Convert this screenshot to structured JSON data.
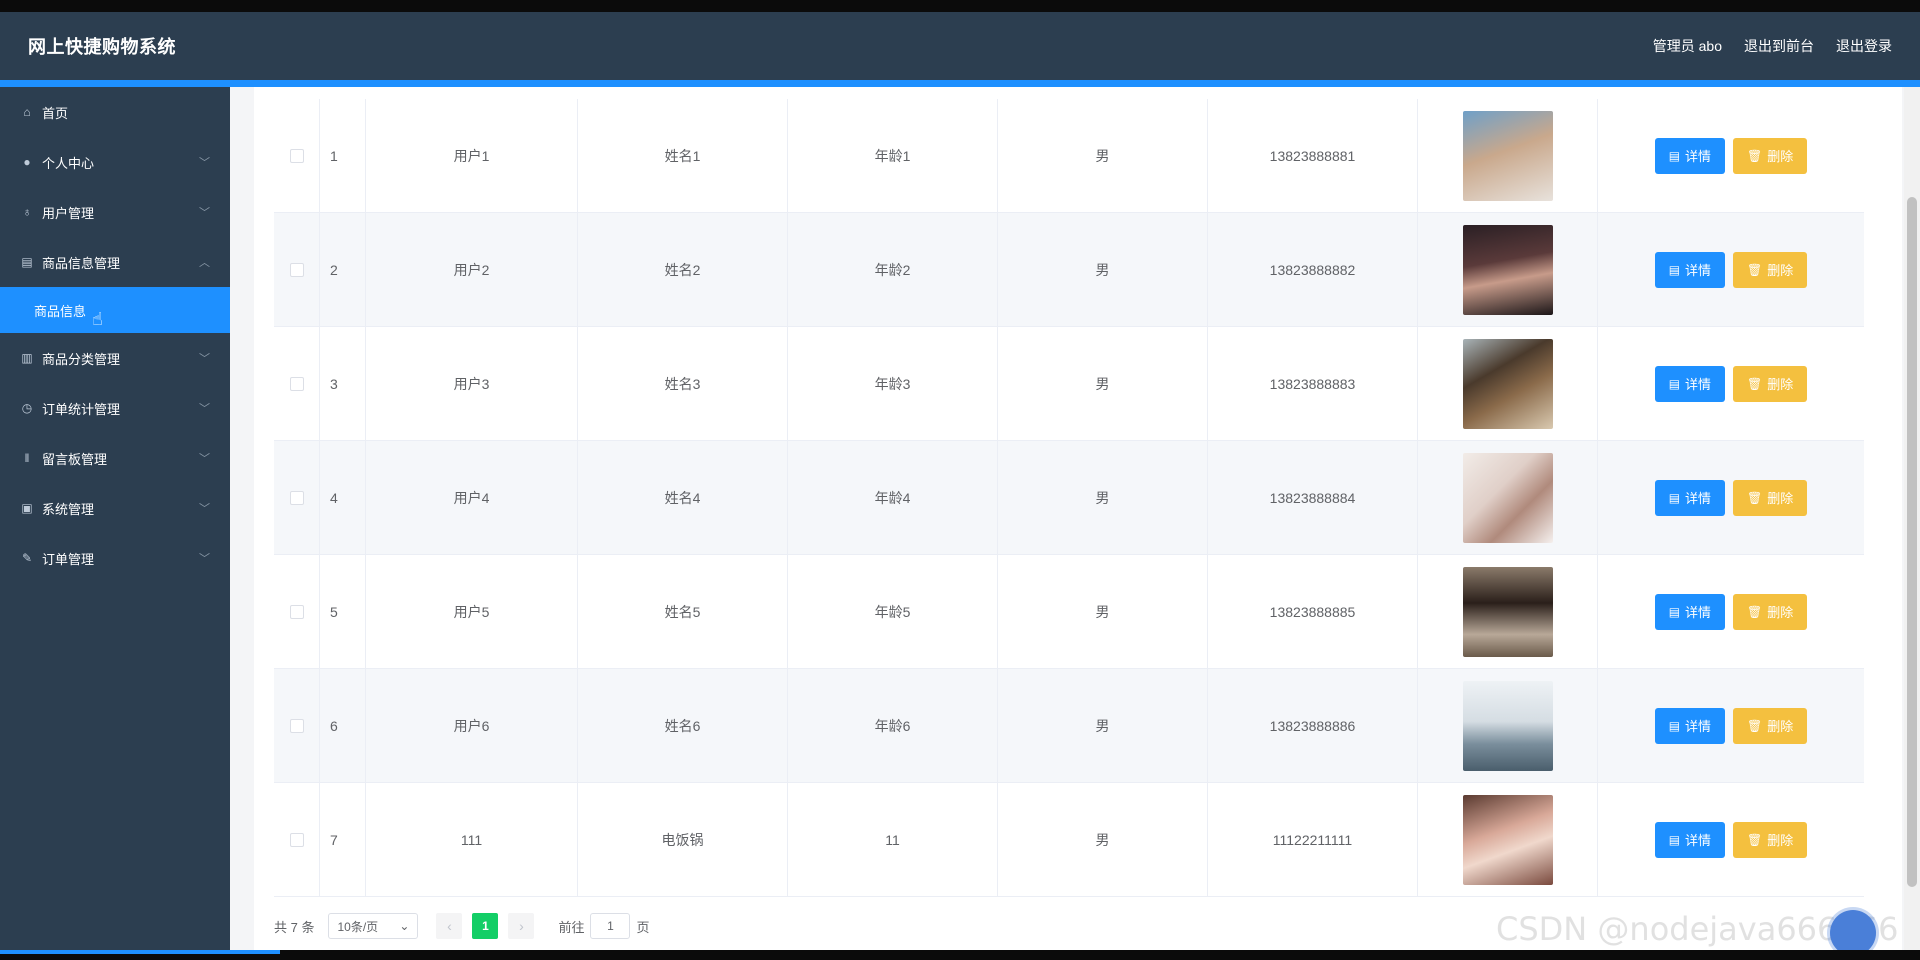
{
  "header": {
    "title": "网上快捷购物系统",
    "admin": "管理员 abo",
    "back_front": "退出到前台",
    "logout": "退出登录"
  },
  "sidebar": {
    "items": [
      {
        "label": "首页",
        "icon": "home-icon"
      },
      {
        "label": "个人中心",
        "icon": "user-icon"
      },
      {
        "label": "用户管理",
        "icon": "mic-icon"
      },
      {
        "label": "商品信息管理",
        "icon": "clipboard-icon"
      },
      {
        "label": "商品分类管理",
        "icon": "bars-icon"
      },
      {
        "label": "订单统计管理",
        "icon": "clock-icon"
      },
      {
        "label": "留言板管理",
        "icon": "bulb-icon"
      },
      {
        "label": "系统管理",
        "icon": "gift-icon"
      },
      {
        "label": "订单管理",
        "icon": "pen-icon"
      }
    ],
    "active_sub": "商品信息"
  },
  "table": {
    "rows": [
      {
        "idx": "1",
        "user": "用户1",
        "name": "姓名1",
        "age": "年龄1",
        "sex": "男",
        "phone": "13823888881"
      },
      {
        "idx": "2",
        "user": "用户2",
        "name": "姓名2",
        "age": "年龄2",
        "sex": "男",
        "phone": "13823888882"
      },
      {
        "idx": "3",
        "user": "用户3",
        "name": "姓名3",
        "age": "年龄3",
        "sex": "男",
        "phone": "13823888883"
      },
      {
        "idx": "4",
        "user": "用户4",
        "name": "姓名4",
        "age": "年龄4",
        "sex": "男",
        "phone": "13823888884"
      },
      {
        "idx": "5",
        "user": "用户5",
        "name": "姓名5",
        "age": "年龄5",
        "sex": "男",
        "phone": "13823888885"
      },
      {
        "idx": "6",
        "user": "用户6",
        "name": "姓名6",
        "age": "年龄6",
        "sex": "男",
        "phone": "13823888886"
      },
      {
        "idx": "7",
        "user": "111",
        "name": "电饭锅",
        "age": "11",
        "sex": "男",
        "phone": "11122211111"
      }
    ],
    "detail_label": "详情",
    "delete_label": "删除"
  },
  "pagination": {
    "total": "共 7 条",
    "page_size": "10条/页",
    "current_page": "1",
    "goto_label": "前往",
    "goto_value": "1",
    "page_unit": "页"
  },
  "watermark": "CSDN @nodejava666666",
  "colors": {
    "header_bg": "#2c3e50",
    "accent": "#1e90ff",
    "delete_btn": "#f4c03f",
    "page_active": "#13ce66"
  }
}
